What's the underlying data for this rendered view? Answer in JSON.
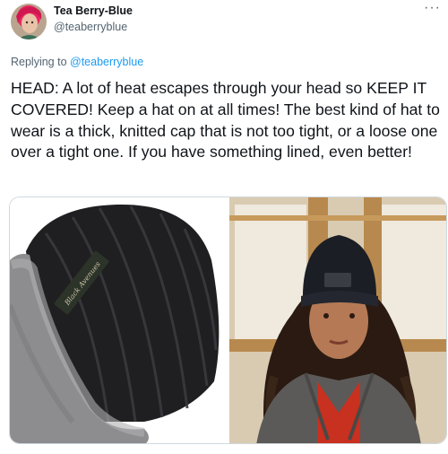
{
  "author": {
    "display_name": "Tea Berry-Blue",
    "handle": "@teaberryblue",
    "avatar_icon": "avatar"
  },
  "reply": {
    "prefix": "Replying to ",
    "mention": "@teaberryblue"
  },
  "tweet": {
    "text": "HEAD: A lot of heat escapes through your head so KEEP IT COVERED! Keep a hat on at all times! The best kind of hat to wear is a thick, knitted cap that is not too tight, or a loose one over a tight one. If you have something lined, even better!"
  },
  "media": {
    "left_label_text": "Black Avenues",
    "left_alt": "black knitted beanie with gray fleece lining",
    "right_alt": "woman wearing black beanie"
  },
  "more_glyph": "···",
  "colors": {
    "link": "#1d9bf0",
    "muted": "#536471",
    "text": "#0f1419",
    "border": "#cfd9de"
  }
}
